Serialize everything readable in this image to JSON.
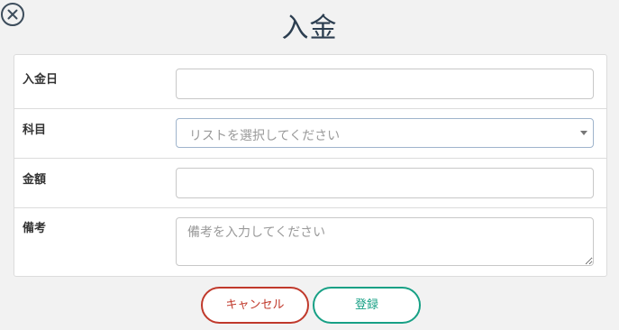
{
  "modal": {
    "title": "入金"
  },
  "icons": {
    "close": "close-circle-icon",
    "dropdown": "caret-down-icon"
  },
  "form": {
    "date_label": "入金日",
    "date_value": "",
    "category_label": "科目",
    "category_placeholder": "リストを選択してください",
    "amount_label": "金額",
    "amount_value": "",
    "note_label": "備考",
    "note_placeholder": "備考を入力してください"
  },
  "actions": {
    "cancel_label": "キャンセル",
    "submit_label": "登録"
  },
  "colors": {
    "cancel": "#c0392b",
    "submit": "#17a085",
    "title": "#2c3e50"
  }
}
